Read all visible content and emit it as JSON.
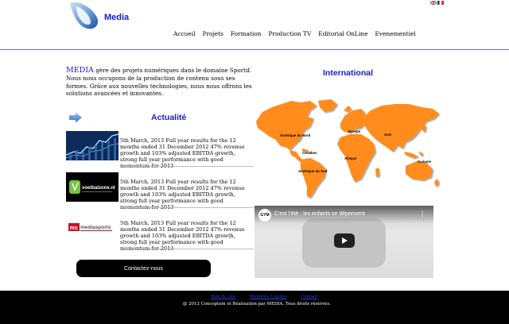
{
  "brand": {
    "name": "Media",
    "logo_icon": "logo-swirl-icon"
  },
  "languages": [
    {
      "code": "en",
      "icon": "uk-flag-icon"
    },
    {
      "code": "fr",
      "icon": "fr-flag-icon"
    }
  ],
  "nav": {
    "items": [
      {
        "label": "Accueil"
      },
      {
        "label": "Projets"
      },
      {
        "label": "Formation"
      },
      {
        "label": "Production TV"
      },
      {
        "label": "Editorial OnLine"
      },
      {
        "label": "Evenementiel"
      }
    ]
  },
  "intro": {
    "brand_word": "MEDIA",
    "text": " gère des projets numériques dans le domaine Sportif. Nous nous occupons de la production de contenu sous ses formes. Grâce aux nouvelles technologies, nous nous offrons les solutions avancées et innovantes."
  },
  "actualite": {
    "title": "Actualité",
    "items": [
      {
        "thumb": "stock-chart-thumbnail",
        "text": "5th March, 2013 Full year results for the 12 months ended 31 December 2012 47% revenue growth and 103% adjusted EBITDA growth, strong full year performance with good momentum for 2013"
      },
      {
        "thumb": "voetbalzone-thumbnail",
        "thumb_text": "voetbalzone.nl",
        "text": "5th March, 2013 Full year results for the 12 months ended 31 December 2012 47% revenue growth and 103% adjusted EBITDA growth, strong full year performance with good momentum for 2013"
      },
      {
        "thumb": "mediasports-thumbnail",
        "thumb_text": "mediasports",
        "text": "5th March, 2013 Full year results for the 12 months ended 31 December 2012 47% revenue growth and 103% adjusted EBITDA growth, strong full year performance with good momentum for 2013"
      }
    ]
  },
  "contact": {
    "label": "Contactez-nous"
  },
  "international": {
    "title": "International",
    "regions": [
      "Amérique du Nord",
      "Caraïbes",
      "Amérique du Sud",
      "Europe",
      "Afrique",
      "Asie",
      "Océanie"
    ]
  },
  "video": {
    "channel": "GYM",
    "title": "C'est l'été : les enfants se dépensent"
  },
  "footer": {
    "links": [
      {
        "label": "Plan du site"
      },
      {
        "label": "Mentions Légales"
      },
      {
        "label": "Contact"
      }
    ],
    "copyright": "@ 2013 Conception et Réalisation par MEDIA. Tous droits réservés."
  },
  "colors": {
    "accent": "#1a1acc",
    "map": "#ff8c1a",
    "header_line": "#5a6bf0"
  }
}
